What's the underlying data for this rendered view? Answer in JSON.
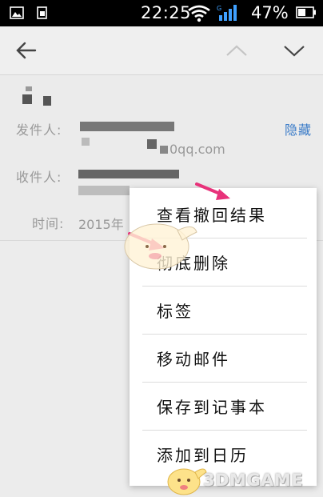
{
  "status_bar": {
    "time": "22:25",
    "battery_percent": "47%",
    "icons": [
      "gallery-icon",
      "notification-icon",
      "wifi-icon",
      "signal-icon",
      "battery-icon"
    ]
  },
  "action_bar": {
    "icons": [
      "back-arrow-icon",
      "chevron-up-icon",
      "chevron-down-icon"
    ]
  },
  "mail": {
    "from_label": "发件人:",
    "hide_link": "隐藏",
    "from_domain": "0qq.com",
    "to_label": "收件人:",
    "time_label": "时间:",
    "time_value": "2015年"
  },
  "menu": {
    "items": [
      {
        "label": "查看撤回结果"
      },
      {
        "label": "彻底删除"
      },
      {
        "label": "标签"
      },
      {
        "label": "移动邮件"
      },
      {
        "label": "保存到记事本"
      },
      {
        "label": "添加到日历"
      }
    ]
  },
  "watermark": "3DMGAME",
  "colors": {
    "accent": "#3a7bc8",
    "annotation": "#e8327a"
  }
}
